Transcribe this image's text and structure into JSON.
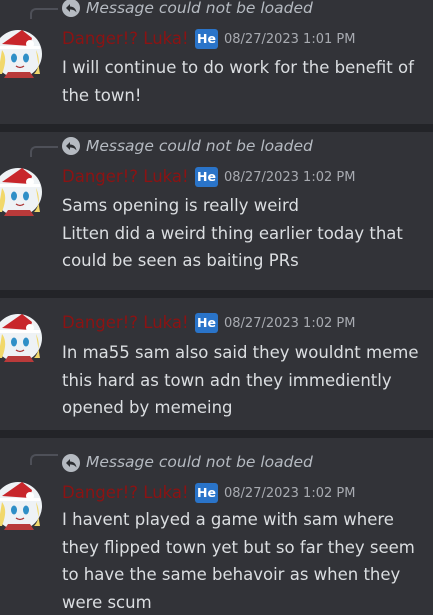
{
  "messages": [
    {
      "reply_text": "Message could not be loaded",
      "author": "Danger!? Luka!",
      "tag": "He",
      "timestamp": "08/27/2023 1:01 PM",
      "lines": [
        "I will continue to do work for the benefit of",
        "the town!"
      ]
    },
    {
      "reply_text": "Message could not be loaded",
      "author": "Danger!? Luka!",
      "tag": "He",
      "timestamp": "08/27/2023 1:02 PM",
      "lines": [
        "Sams opening is really weird",
        "Litten did a weird thing earlier today that",
        "could be seen as baiting PRs"
      ]
    },
    {
      "author": "Danger!? Luka!",
      "tag": "He",
      "timestamp": "08/27/2023 1:02 PM",
      "lines": [
        "In ma55 sam also said they wouldnt meme",
        "this hard as town adn they immediently",
        "opened by memeing"
      ]
    },
    {
      "reply_text": "Message could not be loaded",
      "author": "Danger!? Luka!",
      "tag": "He",
      "timestamp": "08/27/2023 1:02 PM",
      "lines": [
        "I havent played a game with sam where",
        "they flipped town yet but so far they seem",
        "to have the same behavoir as when they",
        "were scum"
      ]
    }
  ],
  "colors": {
    "background": "#323338",
    "divider": "#232428",
    "author": "#8b1313",
    "tag_bg": "#2a74c9",
    "text": "#dbdee1",
    "muted": "#a8abb1"
  },
  "icons": {
    "reply": "reply-arrow-icon",
    "avatar": "avatar"
  }
}
